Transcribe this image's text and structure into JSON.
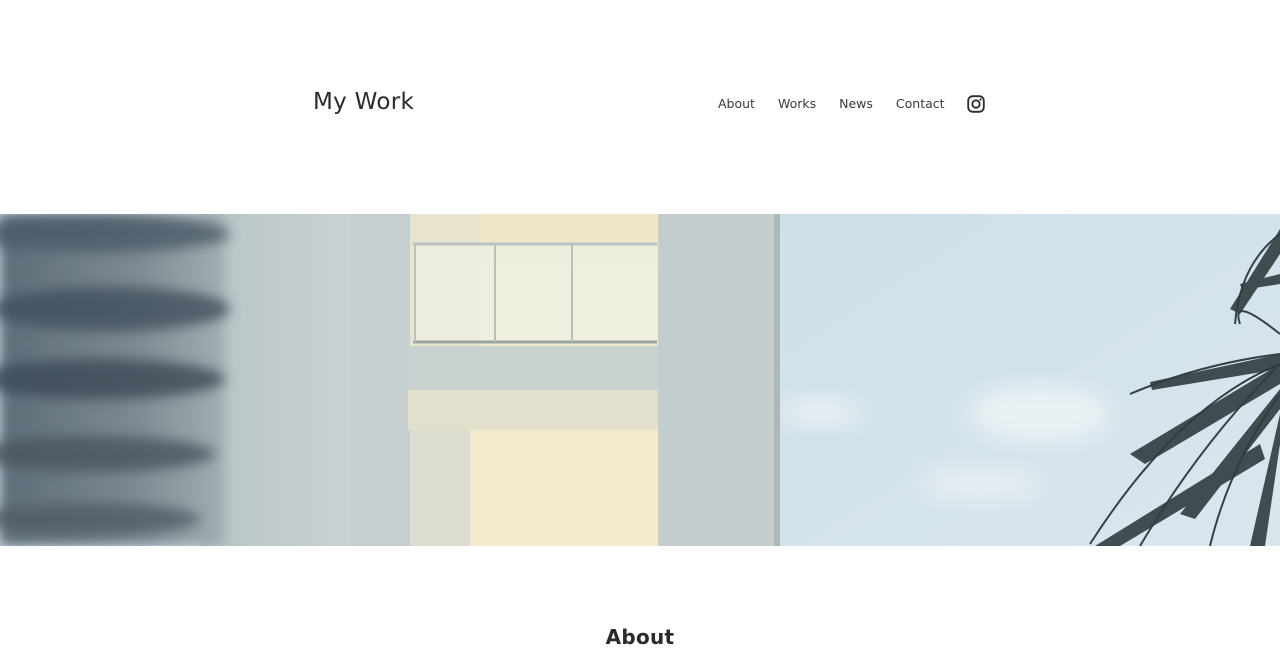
{
  "site": {
    "title": "My Work"
  },
  "nav": {
    "items": [
      {
        "label": "About"
      },
      {
        "label": "Works"
      },
      {
        "label": "News"
      },
      {
        "label": "Contact"
      }
    ],
    "social_icon": "instagram-icon"
  },
  "hero": {
    "image": "building-balcony-palm-photo"
  },
  "main": {
    "section_title": "About"
  }
}
